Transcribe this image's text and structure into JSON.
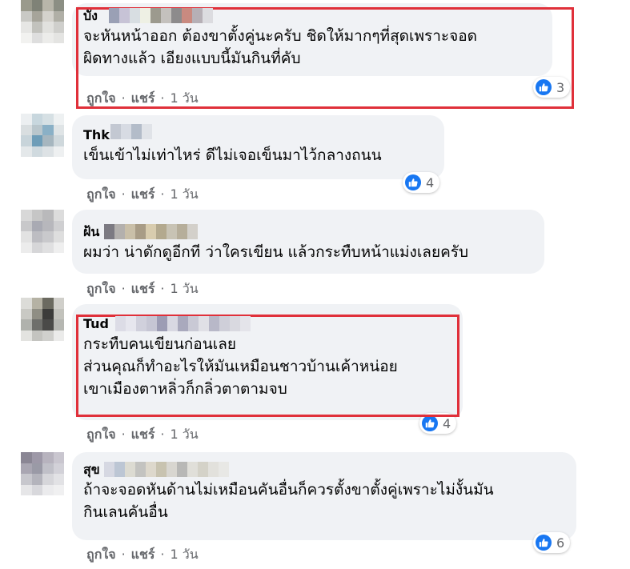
{
  "comments": [
    {
      "author": "บัง",
      "lines": [
        "จะหันหน้าออก ต้องขาตั้งคู่นะครับ ชิดให้มากๆที่สุดเพราะจอด",
        "ผิดทางแล้ว เอียงแบบนี้มันกินที่คับ"
      ],
      "like_label": "ถูกใจ",
      "separator": "·",
      "share_label": "แชร์",
      "time": "1 วัน",
      "reaction_count": "3"
    },
    {
      "author": "Thk ham",
      "lines": [
        "เข็นเข้าไม่เท่าไหร่ ดีไม่เจอเข็นมาไว้กลางถนน"
      ],
      "like_label": "ถูกใจ",
      "separator": "·",
      "share_label": "แชร์",
      "time": "1 วัน",
      "reaction_count": "4"
    },
    {
      "author": "ฝ้น",
      "lines": [
        "ผมว่า น่าดักดูอีกที ว่าใครเขียน แล้วกระทืบหน้าแม่งเลยครับ"
      ],
      "like_label": "ถูกใจ",
      "separator": "·",
      "share_label": "แชร์",
      "time": "1 วัน",
      "reaction_count": ""
    },
    {
      "author": "Tud",
      "lines": [
        "กระทืบคนเขียนก่อนเลย",
        "ส่วนคุณก็ทำอะไรให้มันเหมือนชาวบ้านเค้าหน่อย",
        "เขาเมืองตาหลิ่วก็กลิ่วตาตามจบ"
      ],
      "like_label": "ถูกใจ",
      "separator": "·",
      "share_label": "แชร์",
      "time": "1 วัน",
      "reaction_count": "4"
    },
    {
      "author": "สุข",
      "lines": [
        "ถ้าจะจอดหันด้านไม่เหมือนคันอื่นก็ควรตั้งขาตั้งคู่เพราะไม่งั้นมัน",
        "กินเลนคันอื่น"
      ],
      "like_label": "ถูกใจ",
      "separator": "·",
      "share_label": "แชร์",
      "time": "1 วัน",
      "reaction_count": "6"
    }
  ],
  "colors": {
    "bubble": "#f0f2f5",
    "like_blue": "#1877f2",
    "meta_gray": "#65676b",
    "highlight_red": "#e0303a"
  },
  "icons": {
    "reaction": "thumbs-up-icon"
  }
}
